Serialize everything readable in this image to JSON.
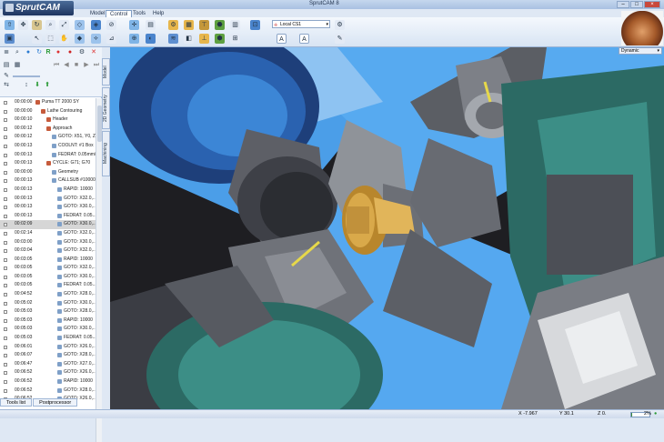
{
  "app": {
    "name": "SprutCAM",
    "window_title": "SprutCAM 8"
  },
  "menu": {
    "tabs": [
      {
        "label": "Model"
      },
      {
        "label": "Control"
      },
      {
        "label": "Tools"
      },
      {
        "label": "Help"
      }
    ],
    "active": "Control"
  },
  "ribbon": {
    "cs_select": "Local CS1"
  },
  "viewport": {
    "mode": "Dynamic"
  },
  "vertical_tabs": [
    "Machining",
    "2D Geometry",
    "Model"
  ],
  "tree": [
    {
      "t": "00:00:00",
      "l": "Puma TT 2000 SY",
      "lvl": 0
    },
    {
      "t": "00:00:00",
      "l": "Lathe Contouring",
      "lvl": 1
    },
    {
      "t": "00:00:10",
      "l": "Header",
      "lvl": 2
    },
    {
      "t": "00:00:12",
      "l": "Approach",
      "lvl": 2
    },
    {
      "t": "00:00:12",
      "l": "GOTO: X51, Y0, Z1",
      "lvl": 3
    },
    {
      "t": "00:00:13",
      "l": "COOLNT: #1 Box",
      "lvl": 3
    },
    {
      "t": "00:00:13",
      "l": "FEDRAT: 0.05mm/O6..",
      "lvl": 3
    },
    {
      "t": "00:00:13",
      "l": "CYCLE: G71; G70",
      "lvl": 2
    },
    {
      "t": "00:00:00",
      "l": "Geometry",
      "lvl": 3
    },
    {
      "t": "00:00:13",
      "l": "CALLSUB #10000...",
      "lvl": 3
    },
    {
      "t": "00:00:13",
      "l": "RAPID: 10000",
      "lvl": 4
    },
    {
      "t": "00:00:13",
      "l": "GOTO: X32.0,...",
      "lvl": 4
    },
    {
      "t": "00:00:13",
      "l": "GOTO: X30.0,...",
      "lvl": 4
    },
    {
      "t": "00:00:13",
      "l": "FEDRAT: 0.05...",
      "lvl": 4
    },
    {
      "t": "00:02:09",
      "l": "GOTO: X30.0,...",
      "lvl": 4,
      "sel": true
    },
    {
      "t": "00:02:14",
      "l": "GOTO: X32.0,...",
      "lvl": 4
    },
    {
      "t": "00:03:00",
      "l": "GOTO: X30.0,...",
      "lvl": 4
    },
    {
      "t": "00:03:04",
      "l": "GOTO: X32.0,...",
      "lvl": 4
    },
    {
      "t": "00:03:05",
      "l": "RAPID: 10000",
      "lvl": 4
    },
    {
      "t": "00:03:05",
      "l": "GOTO: X32.0,...",
      "lvl": 4
    },
    {
      "t": "00:03:05",
      "l": "GOTO: X30.0,...",
      "lvl": 4
    },
    {
      "t": "00:03:05",
      "l": "FEDRAT: 0.05...",
      "lvl": 4
    },
    {
      "t": "00:04:52",
      "l": "GOTO: X28.0,...",
      "lvl": 4
    },
    {
      "t": "00:05:02",
      "l": "GOTO: X30.0,...",
      "lvl": 4
    },
    {
      "t": "00:05:03",
      "l": "GOTO: X28.0,...",
      "lvl": 4
    },
    {
      "t": "00:05:03",
      "l": "RAPID: 10000",
      "lvl": 4
    },
    {
      "t": "00:05:03",
      "l": "GOTO: X30.0,...",
      "lvl": 4
    },
    {
      "t": "00:05:03",
      "l": "FEDRAT: 0.05...",
      "lvl": 4
    },
    {
      "t": "00:06:01",
      "l": "GOTO: X26.0,...",
      "lvl": 4
    },
    {
      "t": "00:06:07",
      "l": "GOTO: X28.0,...",
      "lvl": 4
    },
    {
      "t": "00:06:47",
      "l": "GOTO: X27.0,...",
      "lvl": 4
    },
    {
      "t": "00:06:52",
      "l": "GOTO: X26.0,...",
      "lvl": 4
    },
    {
      "t": "00:06:52",
      "l": "RAPID: 10000",
      "lvl": 4
    },
    {
      "t": "00:06:52",
      "l": "GOTO: X28.0,...",
      "lvl": 4
    },
    {
      "t": "00:06:52",
      "l": "GOTO: X26.0,...",
      "lvl": 4
    }
  ],
  "bottom_tabs": [
    {
      "label": "Tools list"
    },
    {
      "label": "Postprocessor"
    }
  ],
  "status": {
    "x": "X -7.967",
    "y": "Y 30.1",
    "z": "Z 0.",
    "progress": "2%"
  }
}
